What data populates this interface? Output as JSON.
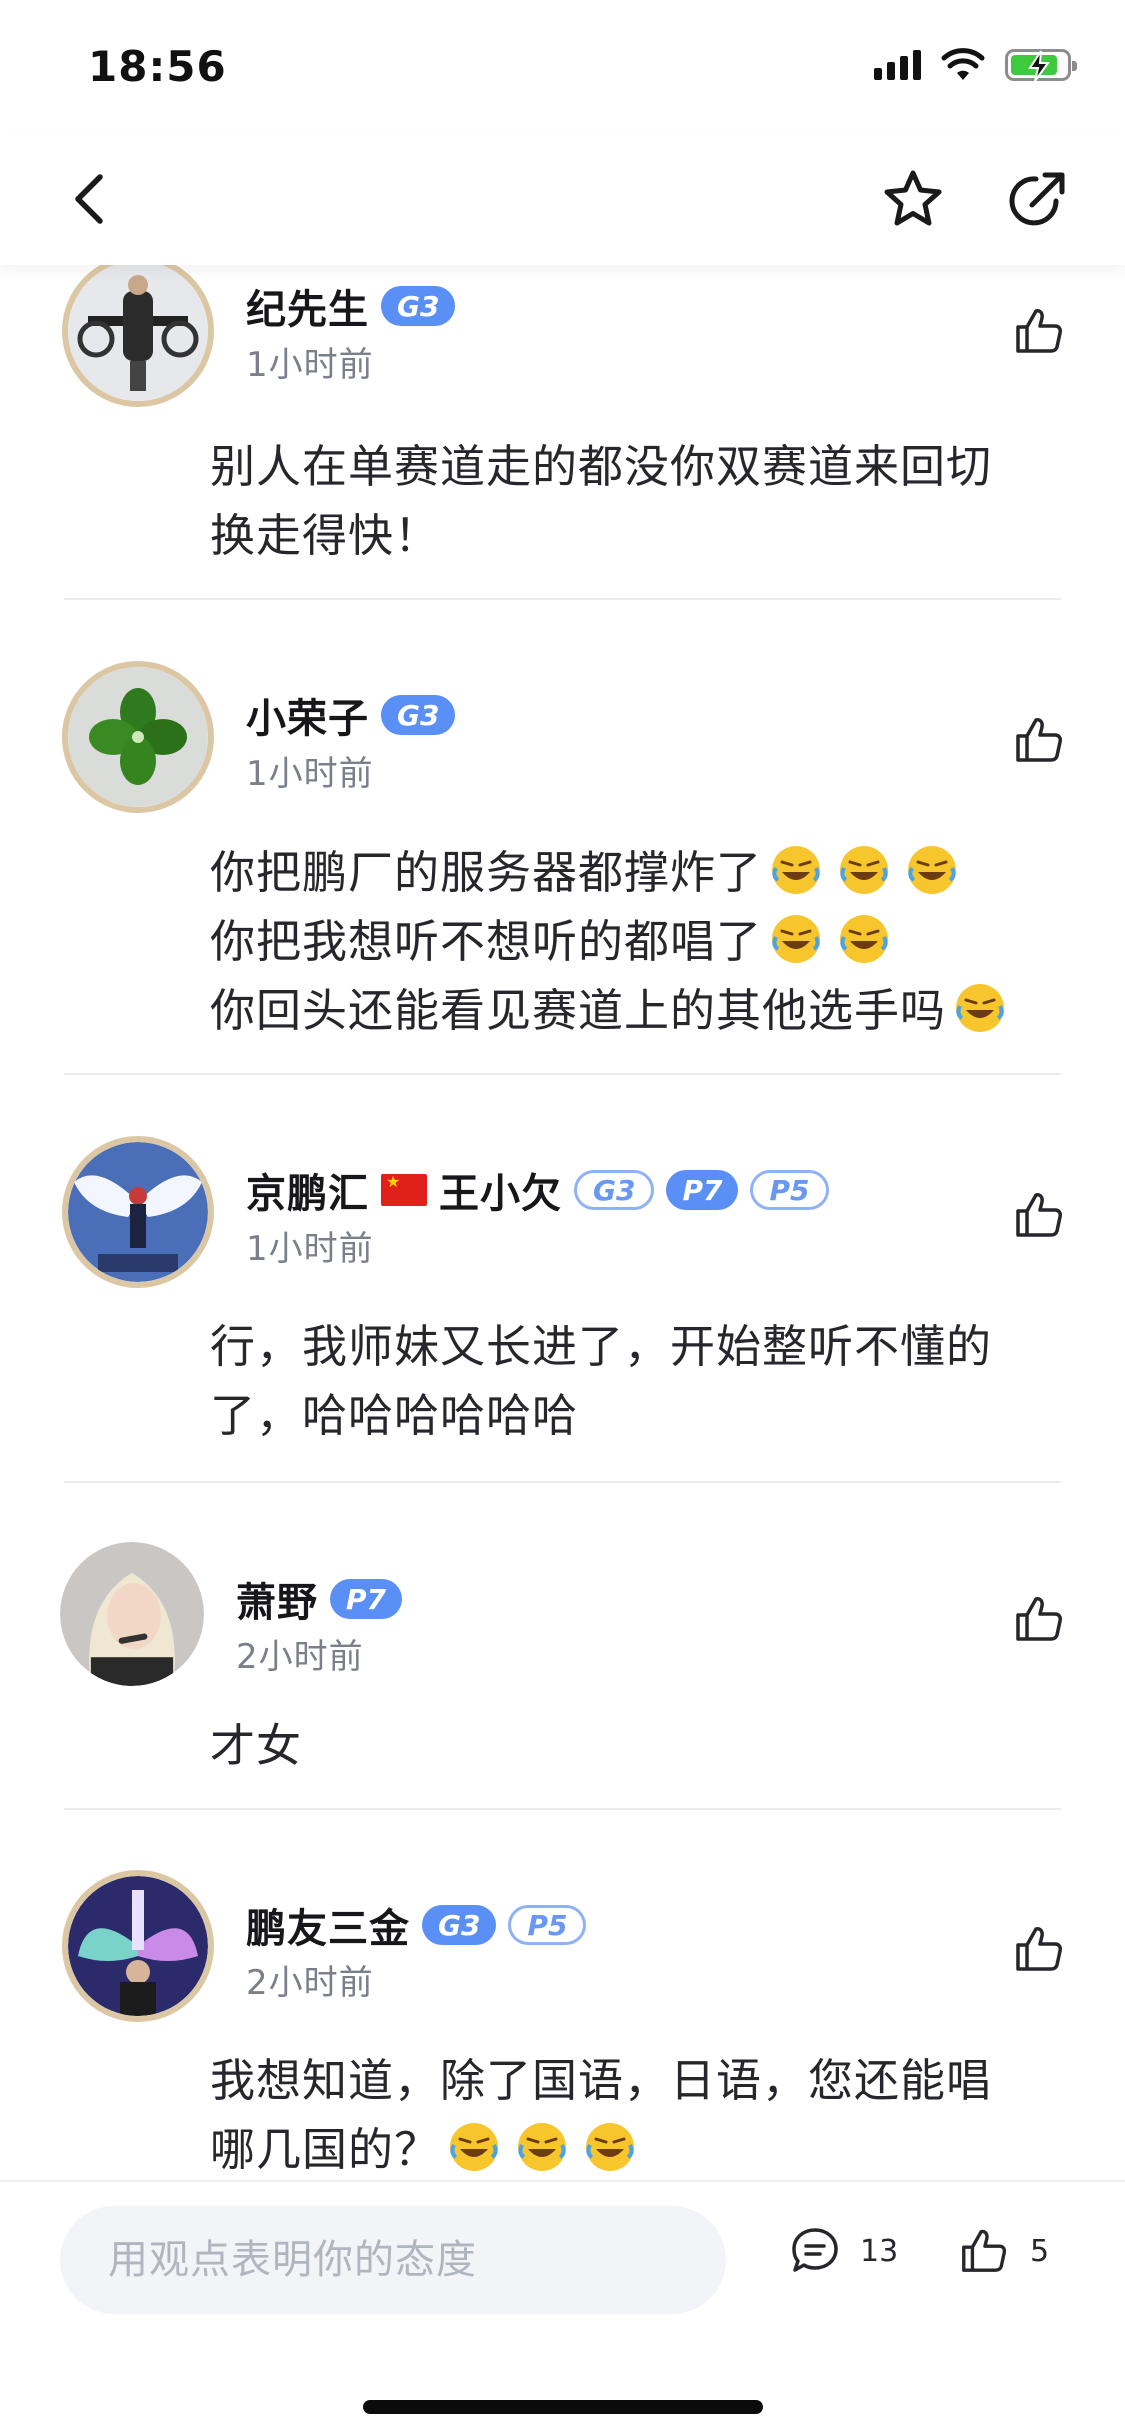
{
  "status_bar": {
    "time": "18:56"
  },
  "comments": [
    {
      "username": "纪先生",
      "badges": [
        "G3"
      ],
      "timestamp": "1小时前",
      "lines": [
        "别人在单赛道走的都没你双赛道来回切",
        "换走得快！"
      ]
    },
    {
      "username": "小荣子",
      "badges": [
        "G3"
      ],
      "timestamp": "1小时前",
      "lines": [
        "你把鹏厂的服务器都撑炸了",
        "你把我想听不想听的都唱了",
        "你回头还能看见赛道上的其他选手吗"
      ],
      "emoji_per_line": [
        3,
        2,
        1
      ]
    },
    {
      "username_prefix": "京鹏汇",
      "username_suffix": "王小欠",
      "badges": [
        "G3",
        "P7",
        "P5"
      ],
      "timestamp": "1小时前",
      "lines": [
        "行，我师妹又长进了，开始整听不懂的",
        "了，哈哈哈哈哈哈"
      ]
    },
    {
      "username": "萧野",
      "badges": [
        "P7"
      ],
      "timestamp": "2小时前",
      "lines": [
        "才女"
      ]
    },
    {
      "username": "鹏友三金",
      "badges": [
        "G3",
        "P5"
      ],
      "timestamp": "2小时前",
      "lines": [
        "我想知道，除了国语，日语，您还能唱",
        "哪几国的？"
      ],
      "emoji_per_line": [
        0,
        3
      ]
    }
  ],
  "bottom_bar": {
    "input_placeholder": "用观点表明你的态度",
    "comment_count": "13",
    "like_count": "5"
  },
  "icons": {
    "back": "chevron-left-icon",
    "favorite": "star-outline-icon",
    "share": "share-arrow-icon",
    "like": "thumbs-up-icon",
    "comment": "speech-bubble-icon",
    "emoji": "rolling-on-floor-laughing-emoji"
  },
  "colors": {
    "badge_blue": "#5a8ff5",
    "avatar_frame": "#dcc7a4",
    "timestamp_gray": "#7a7f8a",
    "input_bg": "#f3f4f7"
  }
}
